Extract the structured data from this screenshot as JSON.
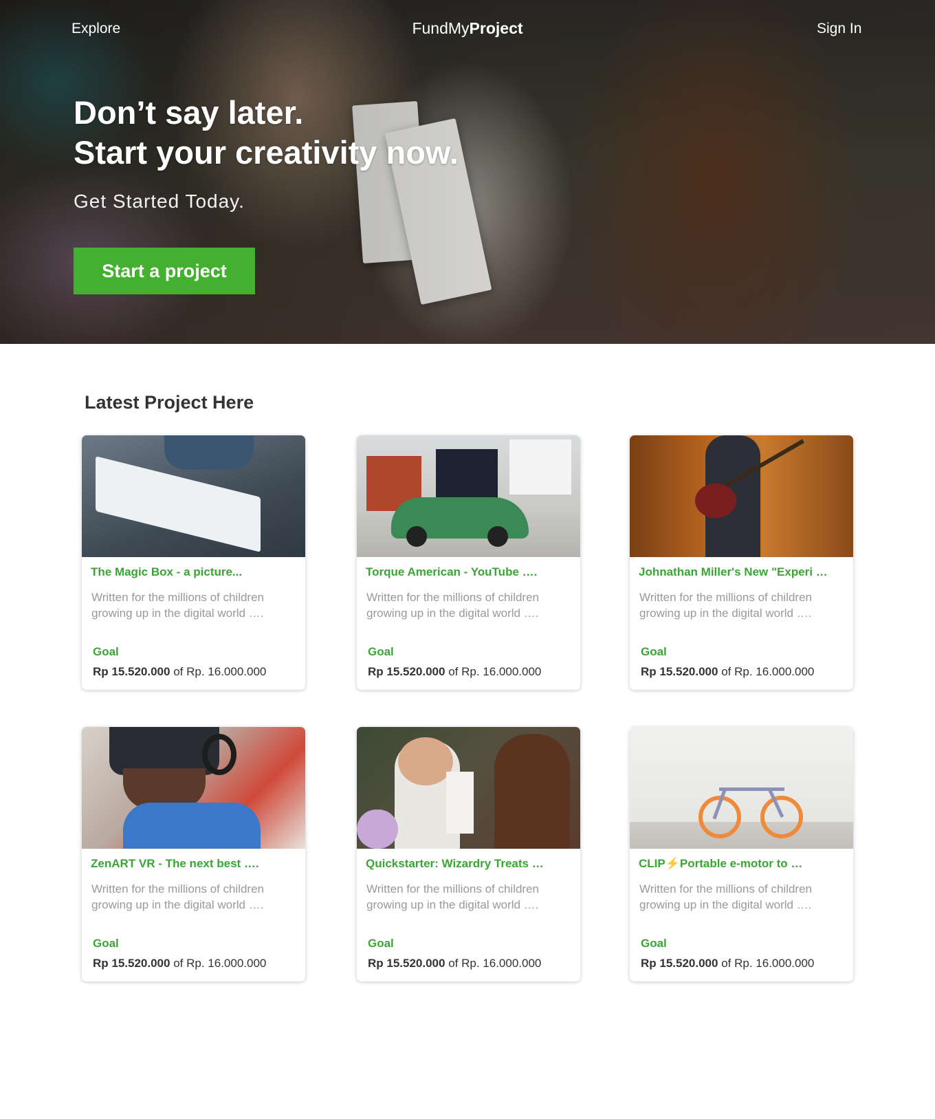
{
  "nav": {
    "explore_label": "Explore",
    "brand_light": "FundMy",
    "brand_bold": "Project",
    "signin_label": "Sign In"
  },
  "hero": {
    "title_line1": "Don’t say later.",
    "title_line2": "Start your creativity now.",
    "subtitle": "Get Started Today.",
    "cta_label": "Start a project"
  },
  "section": {
    "title": "Latest Project Here"
  },
  "projects": [
    {
      "title": "The Magic Box - a picture...",
      "description": "Written for the millions of children growing up in the digital world ….",
      "goal_label": "Goal",
      "raised": "Rp 15.520.000",
      "of_label": "of",
      "goal_amount": "Rp. 16.000.000",
      "image": "book-photo"
    },
    {
      "title": "Torque American - YouTube ….",
      "description": "Written for the millions of children growing up in the digital world ….",
      "goal_label": "Goal",
      "raised": "Rp 15.520.000",
      "of_label": "of",
      "goal_amount": "Rp. 16.000.000",
      "image": "car-photo"
    },
    {
      "title": "Johnathan Miller's New \"Experi …",
      "description": "Written for the millions of children growing up in the digital world ….",
      "goal_label": "Goal",
      "raised": "Rp 15.520.000",
      "of_label": "of",
      "goal_amount": "Rp. 16.000.000",
      "image": "guitar-photo"
    },
    {
      "title": "ZenART VR - The next best ….",
      "description": "Written for the millions of children growing up in the digital world ….",
      "goal_label": "Goal",
      "raised": "Rp 15.520.000",
      "of_label": "of",
      "goal_amount": "Rp. 16.000.000",
      "image": "vr-photo"
    },
    {
      "title": "Quickstarter: Wizardry Treats …",
      "description": "Written for the millions of children growing up in the digital world ….",
      "goal_label": "Goal",
      "raised": "Rp 15.520.000",
      "of_label": "of",
      "goal_amount": "Rp. 16.000.000",
      "image": "party-photo"
    },
    {
      "title": "CLIP⚡Portable e-motor to …",
      "description": "Written for the millions of children growing up in the digital world ….",
      "goal_label": "Goal",
      "raised": "Rp 15.520.000",
      "of_label": "of",
      "goal_amount": "Rp. 16.000.000",
      "image": "bike-photo"
    }
  ],
  "colors": {
    "accent_green": "#44b02f",
    "title_green": "#3aa534",
    "muted_text": "#999999"
  }
}
